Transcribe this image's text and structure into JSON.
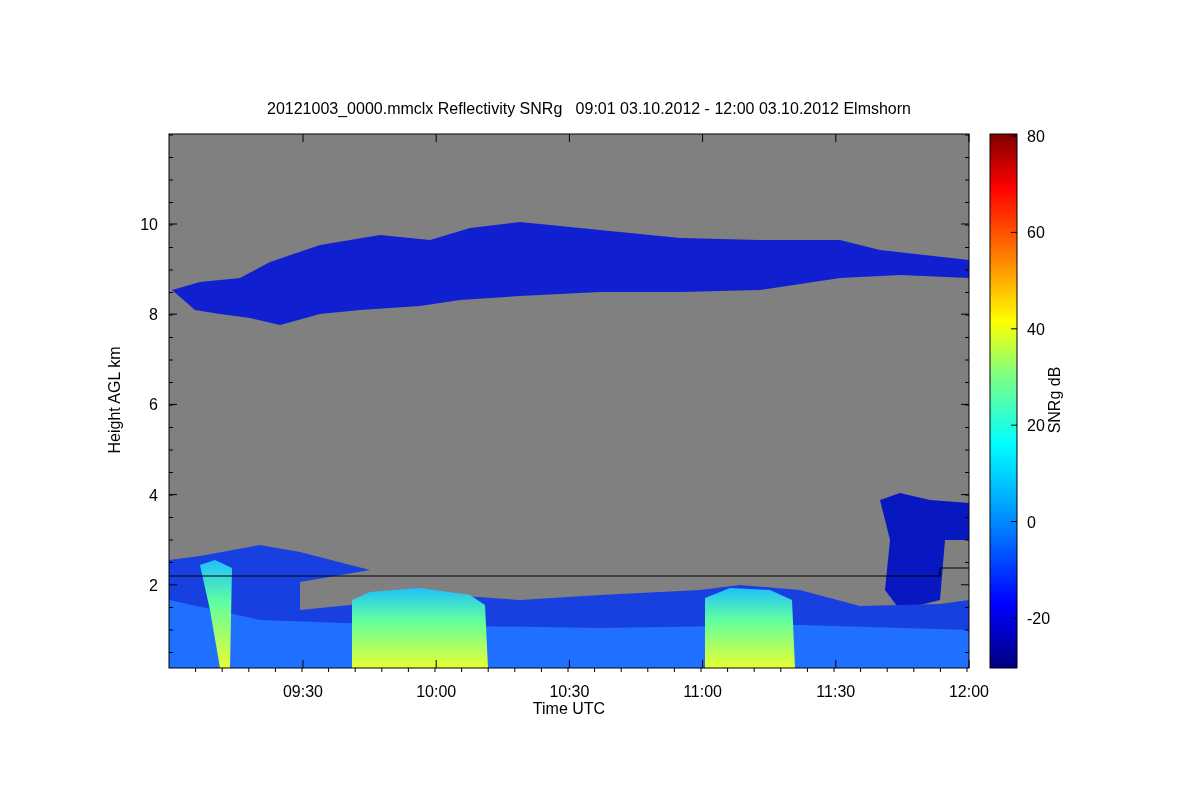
{
  "title": "20121003_0000.mmclx Reflectivity SNRg   09:01 03.10.2012 - 12:00 03.10.2012 Elmshorn",
  "plot": {
    "xlabel": "Time UTC",
    "ylabel": "Height AGL km",
    "xticks": [
      "09:30",
      "10:00",
      "10:30",
      "11:00",
      "11:30",
      "12:00"
    ],
    "yticks": [
      "10",
      "8",
      "6",
      "4",
      "2"
    ]
  },
  "colorbar": {
    "label": "SNRg dB",
    "ticks": [
      "80",
      "60",
      "40",
      "20",
      "0",
      "-20"
    ]
  }
}
